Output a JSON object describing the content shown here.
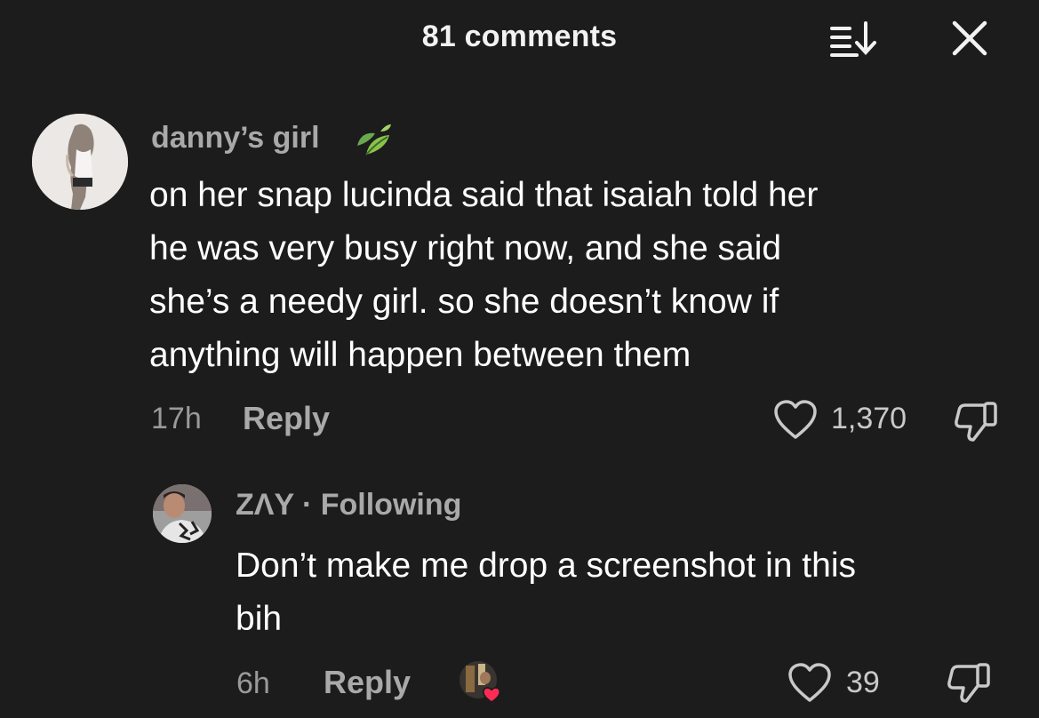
{
  "header": {
    "title": "81 comments",
    "sort_icon": "sort-down-icon",
    "close_icon": "close-icon"
  },
  "comments": [
    {
      "username": "danny’s girl",
      "badge_icon": "leaf-icon",
      "lines": [
        "on her snap lucinda said that isaiah told her",
        "he was very busy right now, and she said",
        "she’s a needy girl. so she doesn’t know if",
        "anything will happen between them"
      ],
      "time": "17h",
      "reply_label": "Reply",
      "likes": "1,370"
    },
    {
      "username": "ZΛY",
      "separator": "·",
      "relation": "Following",
      "lines": [
        "Don’t make me drop a screenshot in this",
        "bih"
      ],
      "time": "6h",
      "reply_label": "Reply",
      "likes": "39",
      "liked_by_creator_icon": "creator-heart-avatar-icon"
    }
  ],
  "colors": {
    "background": "#1c1c1c",
    "text": "#ffffff",
    "muted": "#a9a9a9",
    "heart_red": "#fe2c55"
  }
}
